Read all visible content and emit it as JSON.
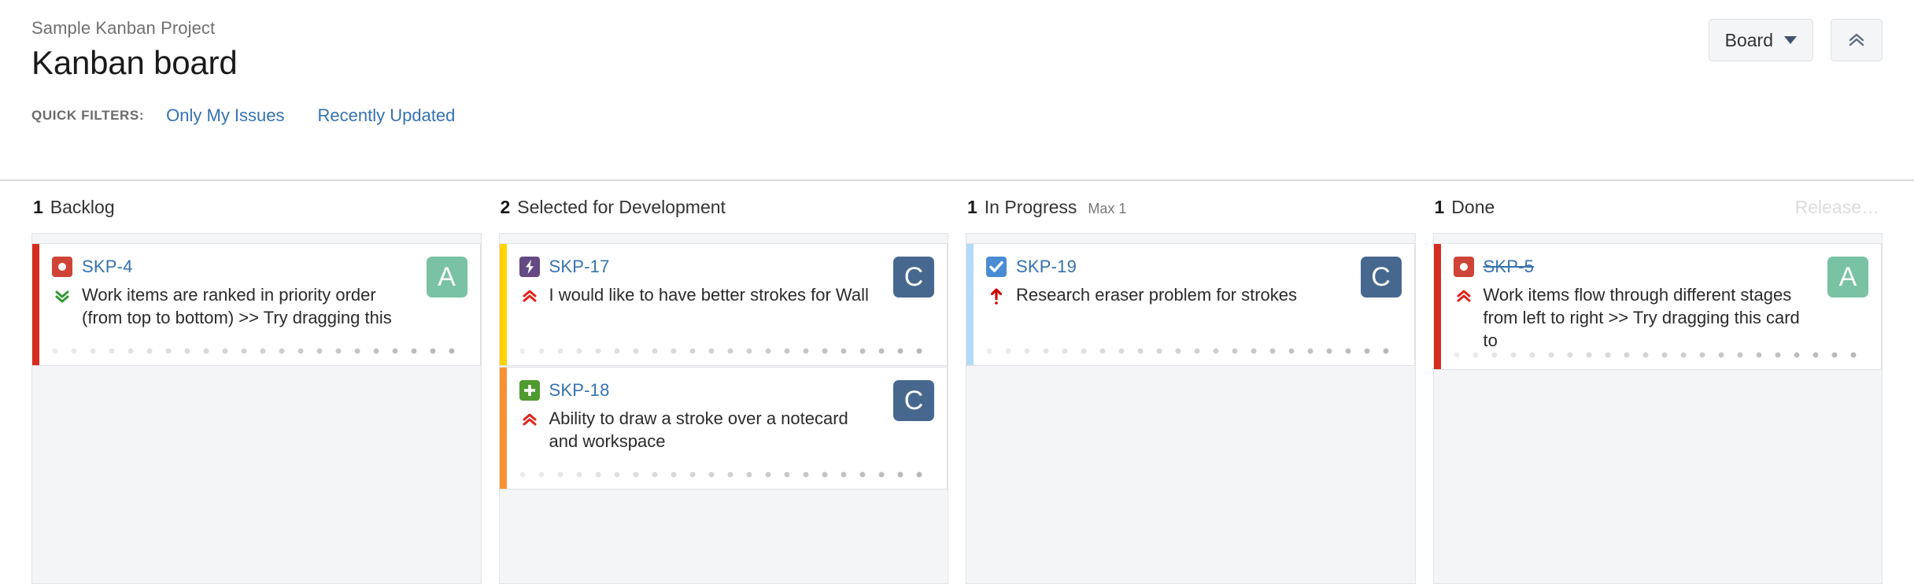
{
  "header": {
    "breadcrumb": "Sample Kanban Project",
    "title": "Kanban board",
    "quick_filters_label": "QUICK FILTERS:",
    "quick_filters": [
      {
        "label": "Only My Issues"
      },
      {
        "label": "Recently Updated"
      }
    ],
    "board_button": "Board",
    "collapse_button_icon": "chevrons-up-icon",
    "link_color": "#3572b0"
  },
  "board": {
    "columns": [
      {
        "count": "1",
        "name": "Backlog",
        "max": "",
        "release": "",
        "cards": [
          {
            "key": "SKP-4",
            "resolved": false,
            "summary": "Work items are ranked in priority order (from top to bottom) >> Try dragging this",
            "stripe_color": "#d42d20",
            "type_icon": "bug-icon",
            "type_icon_color": "#d04437",
            "priority_icon": "low-priority-icon",
            "priority_color": "#339933",
            "avatar_letter": "A",
            "avatar_color": "#79c2a3"
          }
        ]
      },
      {
        "count": "2",
        "name": "Selected for Development",
        "max": "",
        "release": "",
        "cards": [
          {
            "key": "SKP-17",
            "resolved": false,
            "summary": "I would like to have better strokes for Wall",
            "stripe_color": "#ffd400",
            "type_icon": "improvement-bolt-icon",
            "type_icon_color": "#654982",
            "priority_icon": "high-priority-icon",
            "priority_color": "#e2231a",
            "avatar_letter": "C",
            "avatar_color": "#46688f"
          },
          {
            "key": "SKP-18",
            "resolved": false,
            "summary": "Ability to draw a stroke over a notecard and workspace",
            "stripe_color": "#f79232",
            "type_icon": "new-feature-plus-icon",
            "type_icon_color": "#4f9b2f",
            "priority_icon": "high-priority-icon",
            "priority_color": "#e2231a",
            "avatar_letter": "C",
            "avatar_color": "#46688f"
          }
        ]
      },
      {
        "count": "1",
        "name": "In Progress",
        "max": "Max 1",
        "release": "",
        "cards": [
          {
            "key": "SKP-19",
            "resolved": false,
            "summary": "Research eraser problem for strokes",
            "stripe_color": "#b3dbf7",
            "type_icon": "task-check-icon",
            "type_icon_color": "#4a8cd4",
            "priority_icon": "blocker-priority-icon",
            "priority_color": "#cc0000",
            "avatar_letter": "C",
            "avatar_color": "#46688f"
          }
        ]
      },
      {
        "count": "1",
        "name": "Done",
        "max": "",
        "release": "Release…",
        "cards": [
          {
            "key": "SKP-5",
            "resolved": true,
            "summary": "Work items flow through different stages from left to right >> Try dragging this card to",
            "stripe_color": "#d42d20",
            "type_icon": "bug-icon",
            "type_icon_color": "#d04437",
            "priority_icon": "high-priority-icon",
            "priority_color": "#e2231a",
            "avatar_letter": "A",
            "avatar_color": "#79c2a3"
          }
        ]
      }
    ]
  }
}
